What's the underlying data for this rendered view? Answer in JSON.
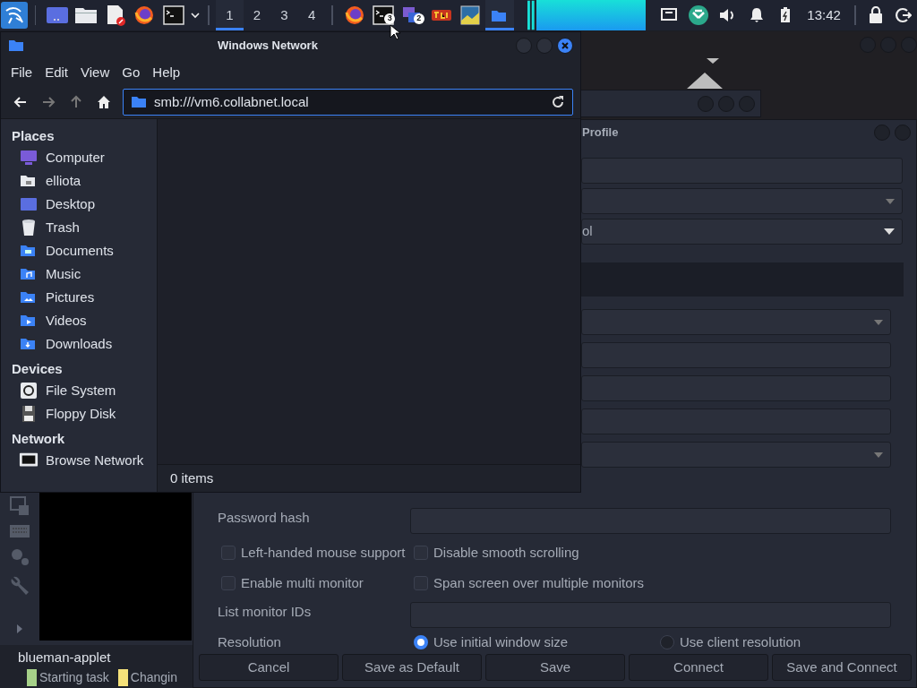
{
  "taskbar": {
    "launchers": [
      {
        "kind": "dragon"
      },
      {
        "kind": "desktop"
      },
      {
        "kind": "files"
      },
      {
        "kind": "editor"
      },
      {
        "kind": "browser"
      },
      {
        "kind": "terminal"
      }
    ],
    "workspaces": [
      {
        "label": "1",
        "selected": true
      },
      {
        "label": "2",
        "selected": false
      },
      {
        "label": "3",
        "selected": false
      },
      {
        "label": "4",
        "selected": false
      }
    ],
    "tasks": [
      {
        "kind": "browser",
        "selected": false
      },
      {
        "kind": "terminal",
        "badge": "3",
        "selected": false
      },
      {
        "kind": "windows",
        "badge": "2",
        "selected": false
      },
      {
        "kind": "game",
        "selected": false
      },
      {
        "kind": "image",
        "selected": false
      },
      {
        "kind": "folder",
        "selected": true
      }
    ],
    "tray": [
      {
        "kind": "network"
      },
      {
        "kind": "app"
      },
      {
        "kind": "volume"
      },
      {
        "kind": "bell"
      },
      {
        "kind": "battery"
      }
    ],
    "clock": "13:42",
    "actions": [
      {
        "kind": "lock"
      },
      {
        "kind": "logout"
      }
    ]
  },
  "file_manager": {
    "title": "Windows Network",
    "menu": [
      "File",
      "Edit",
      "View",
      "Go",
      "Help"
    ],
    "location": "smb:///vm6.collabnet.local",
    "sidebar": [
      {
        "heading": "Places",
        "items": [
          {
            "label": "Computer",
            "kind": "computer"
          },
          {
            "label": "elliota",
            "kind": "home"
          },
          {
            "label": "Desktop",
            "kind": "desktop"
          },
          {
            "label": "Trash",
            "kind": "trash"
          },
          {
            "label": "Documents",
            "kind": "documents"
          },
          {
            "label": "Music",
            "kind": "music"
          },
          {
            "label": "Pictures",
            "kind": "pictures"
          },
          {
            "label": "Videos",
            "kind": "videos"
          },
          {
            "label": "Downloads",
            "kind": "downloads"
          }
        ]
      },
      {
        "heading": "Devices",
        "items": [
          {
            "label": "File System",
            "kind": "drive"
          },
          {
            "label": "Floppy Disk",
            "kind": "floppy"
          }
        ]
      },
      {
        "heading": "Network",
        "items": [
          {
            "label": "Browse Network",
            "kind": "network"
          }
        ]
      }
    ],
    "status": "0 items"
  },
  "profile_window": {
    "title": "Profile",
    "protocol": "ol",
    "password_label": "Password hash",
    "options": [
      {
        "label": "Left-handed mouse support",
        "checked": false
      },
      {
        "label": "Disable smooth scrolling",
        "checked": false
      },
      {
        "label": "Enable multi monitor",
        "checked": false
      },
      {
        "label": "Span screen over multiple monitors",
        "checked": false
      }
    ],
    "monitor_label": "List monitor IDs",
    "resolution_label": "Resolution",
    "resolution_options": [
      {
        "label": "Use initial window size",
        "selected": true
      },
      {
        "label": "Use client resolution",
        "selected": false
      }
    ],
    "buttons": [
      "Cancel",
      "Save as Default",
      "Save",
      "Connect",
      "Save and Connect"
    ]
  },
  "notification": {
    "title": "blueman-applet",
    "items": [
      {
        "label": "Starting task",
        "color": "#a6d189"
      },
      {
        "label": "Changin",
        "color": "#f5e17a"
      }
    ]
  }
}
